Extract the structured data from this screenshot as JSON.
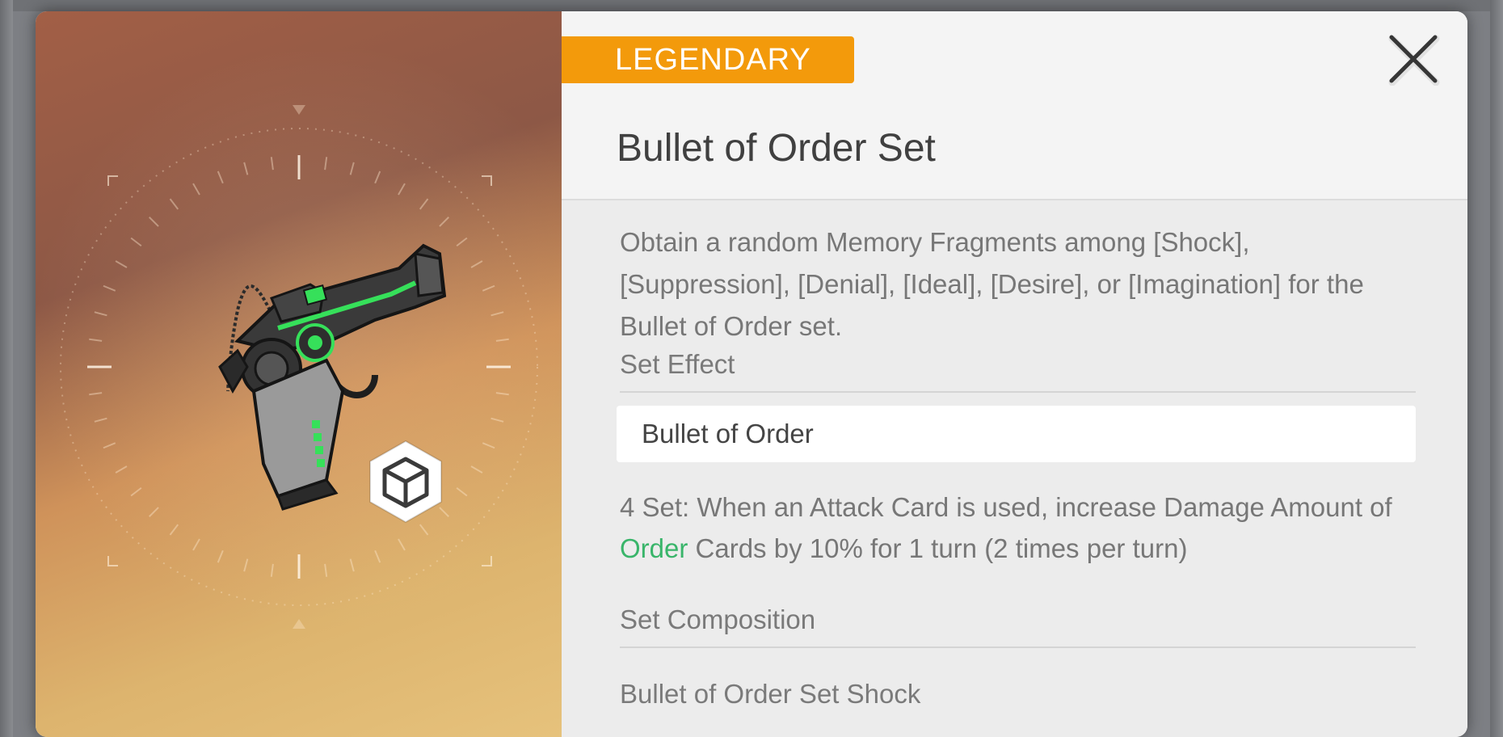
{
  "item": {
    "rarity": "LEGENDARY",
    "title": "Bullet of Order Set",
    "description": "Obtain a random Memory Fragments among [Shock], [Suppression], [Denial], [Ideal], [Desire], or [Imagination] for the Bullet of Order set."
  },
  "set_effect": {
    "heading": "Set Effect",
    "set_name": "Bullet of Order",
    "effect_pre": "4 Set: When an Attack Card is used, increase Damage Amount of ",
    "effect_highlight": "Order",
    "effect_post": " Cards by 10% for 1 turn (2 times per turn)"
  },
  "set_composition": {
    "heading": "Set Composition",
    "items": [
      "Bullet of Order Set Shock"
    ]
  },
  "icons": {
    "close": "close-icon",
    "item_art": "pistol-icon",
    "type_badge": "cube-icon"
  },
  "colors": {
    "rarity": "#f39a0b",
    "highlight": "#39b56a"
  }
}
